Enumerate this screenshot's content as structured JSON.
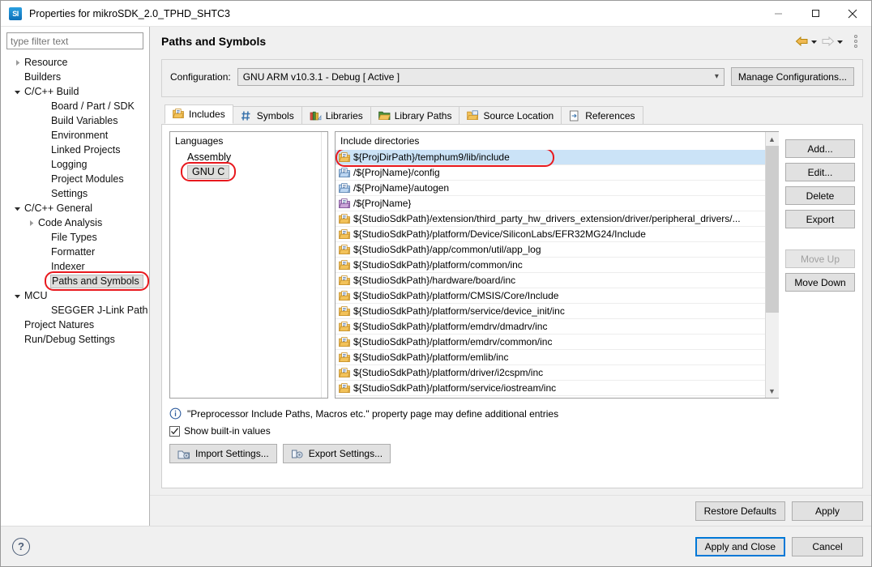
{
  "window": {
    "title": "Properties for mikroSDK_2.0_TPHD_SHTC3",
    "app_icon": "SI",
    "minimize": "—",
    "maximize": "□",
    "close": "✕"
  },
  "filter": {
    "placeholder": "type filter text",
    "value": ""
  },
  "tree": [
    {
      "label": "Resource",
      "level": 0,
      "arrow": "collapsed"
    },
    {
      "label": "Builders",
      "level": 0,
      "arrow": "none"
    },
    {
      "label": "C/C++ Build",
      "level": 0,
      "arrow": "expanded"
    },
    {
      "label": "Board / Part / SDK",
      "level": 1,
      "arrow": "none"
    },
    {
      "label": "Build Variables",
      "level": 1,
      "arrow": "none"
    },
    {
      "label": "Environment",
      "level": 1,
      "arrow": "none"
    },
    {
      "label": "Linked Projects",
      "level": 1,
      "arrow": "none"
    },
    {
      "label": "Logging",
      "level": 1,
      "arrow": "none"
    },
    {
      "label": "Project Modules",
      "level": 1,
      "arrow": "none"
    },
    {
      "label": "Settings",
      "level": 1,
      "arrow": "none"
    },
    {
      "label": "C/C++ General",
      "level": 0,
      "arrow": "expanded"
    },
    {
      "label": "Code Analysis",
      "level": 1,
      "arrow": "collapsed"
    },
    {
      "label": "File Types",
      "level": 1,
      "arrow": "none"
    },
    {
      "label": "Formatter",
      "level": 1,
      "arrow": "none"
    },
    {
      "label": "Indexer",
      "level": 1,
      "arrow": "none"
    },
    {
      "label": "Paths and Symbols",
      "level": 1,
      "arrow": "none",
      "selected": true,
      "annotated": true
    },
    {
      "label": "MCU",
      "level": 0,
      "arrow": "expanded"
    },
    {
      "label": "SEGGER J-Link Path",
      "level": 1,
      "arrow": "none"
    },
    {
      "label": "Project Natures",
      "level": 0,
      "arrow": "none"
    },
    {
      "label": "Run/Debug Settings",
      "level": 0,
      "arrow": "none"
    }
  ],
  "page": {
    "title": "Paths and Symbols",
    "back_icon": "back-arrow-icon",
    "forward_icon": "forward-arrow-icon",
    "menu_icon": "view-menu-icon"
  },
  "configuration": {
    "label": "Configuration:",
    "value": "GNU ARM v10.3.1 - Debug  [ Active ]",
    "manage_label": "Manage Configurations..."
  },
  "tabs": [
    {
      "label": "Includes",
      "icon": "includes-icon",
      "active": true
    },
    {
      "label": "Symbols",
      "icon": "hash-icon",
      "active": false
    },
    {
      "label": "Libraries",
      "icon": "books-icon",
      "active": false
    },
    {
      "label": "Library Paths",
      "icon": "library-paths-icon",
      "active": false
    },
    {
      "label": "Source Location",
      "icon": "source-folder-icon",
      "active": false
    },
    {
      "label": "References",
      "icon": "references-icon",
      "active": false
    }
  ],
  "languages": {
    "header": "Languages",
    "items": [
      {
        "label": "Assembly",
        "selected": false
      },
      {
        "label": "GNU C",
        "selected": true,
        "annotated": true
      }
    ]
  },
  "include_directories": {
    "header": "Include directories",
    "items": [
      {
        "path": "${ProjDirPath}/temphum9/lib/include",
        "icon": "orange-folder-icon",
        "selected": true,
        "annotated": true
      },
      {
        "path": "/${ProjName}/config",
        "icon": "blue-folder-icon",
        "selected": false
      },
      {
        "path": "/${ProjName}/autogen",
        "icon": "blue-folder-icon",
        "selected": false
      },
      {
        "path": "/${ProjName}",
        "icon": "purple-folder-icon",
        "selected": false
      },
      {
        "path": "${StudioSdkPath}/extension/third_party_hw_drivers_extension/driver/peripheral_drivers/...",
        "icon": "orange-folder-icon",
        "selected": false
      },
      {
        "path": "${StudioSdkPath}/platform/Device/SiliconLabs/EFR32MG24/Include",
        "icon": "orange-folder-icon",
        "selected": false
      },
      {
        "path": "${StudioSdkPath}/app/common/util/app_log",
        "icon": "orange-folder-icon",
        "selected": false
      },
      {
        "path": "${StudioSdkPath}/platform/common/inc",
        "icon": "orange-folder-icon",
        "selected": false
      },
      {
        "path": "${StudioSdkPath}/hardware/board/inc",
        "icon": "orange-folder-icon",
        "selected": false
      },
      {
        "path": "${StudioSdkPath}/platform/CMSIS/Core/Include",
        "icon": "orange-folder-icon",
        "selected": false
      },
      {
        "path": "${StudioSdkPath}/platform/service/device_init/inc",
        "icon": "orange-folder-icon",
        "selected": false
      },
      {
        "path": "${StudioSdkPath}/platform/emdrv/dmadrv/inc",
        "icon": "orange-folder-icon",
        "selected": false
      },
      {
        "path": "${StudioSdkPath}/platform/emdrv/common/inc",
        "icon": "orange-folder-icon",
        "selected": false
      },
      {
        "path": "${StudioSdkPath}/platform/emlib/inc",
        "icon": "orange-folder-icon",
        "selected": false
      },
      {
        "path": "${StudioSdkPath}/platform/driver/i2cspm/inc",
        "icon": "orange-folder-icon",
        "selected": false
      },
      {
        "path": "${StudioSdkPath}/platform/service/iostream/inc",
        "icon": "orange-folder-icon",
        "selected": false
      }
    ]
  },
  "side_buttons": [
    {
      "label": "Add...",
      "disabled": false
    },
    {
      "label": "Edit...",
      "disabled": false
    },
    {
      "label": "Delete",
      "disabled": false
    },
    {
      "label": "Export",
      "disabled": false
    },
    {
      "label": "Move Up",
      "disabled": true
    },
    {
      "label": "Move Down",
      "disabled": false
    }
  ],
  "info_note": "\"Preprocessor Include Paths, Macros etc.\" property page may define additional entries",
  "show_builtin": {
    "label": "Show built-in values",
    "checked": true,
    "check_glyph": "✓"
  },
  "settings_buttons": [
    {
      "label": "Import Settings...",
      "icon": "import-settings-icon"
    },
    {
      "label": "Export Settings...",
      "icon": "export-settings-icon"
    }
  ],
  "footer": {
    "restore_defaults": "Restore Defaults",
    "apply": "Apply",
    "apply_and_close": "Apply and Close",
    "cancel": "Cancel",
    "help_glyph": "?"
  },
  "colors": {
    "annotation": "#e8191e",
    "selection": "#cbe3f7",
    "default_button_border": "#0078d7",
    "accent_back_arrow": "#e8a33d"
  }
}
